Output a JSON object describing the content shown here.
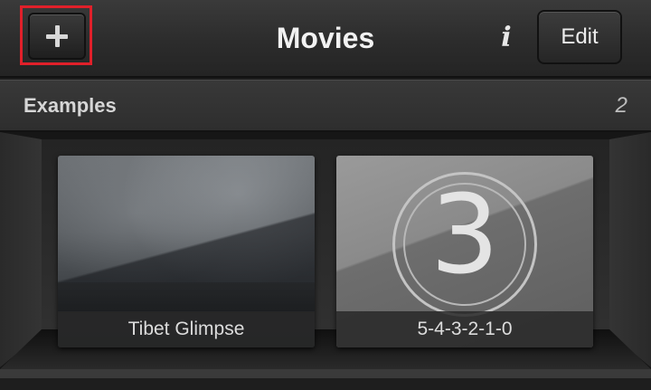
{
  "header": {
    "title": "Movies",
    "add_icon": "plus-icon",
    "info_icon": "info-icon",
    "info_glyph": "i",
    "edit_label": "Edit"
  },
  "section": {
    "title": "Examples",
    "count": "2"
  },
  "movies": [
    {
      "title": "Tibet Glimpse"
    },
    {
      "title": "5-4-3-2-1-0",
      "thumb_number": "3"
    }
  ],
  "colors": {
    "highlight": "#e0202a",
    "background": "#1c1c1c"
  }
}
